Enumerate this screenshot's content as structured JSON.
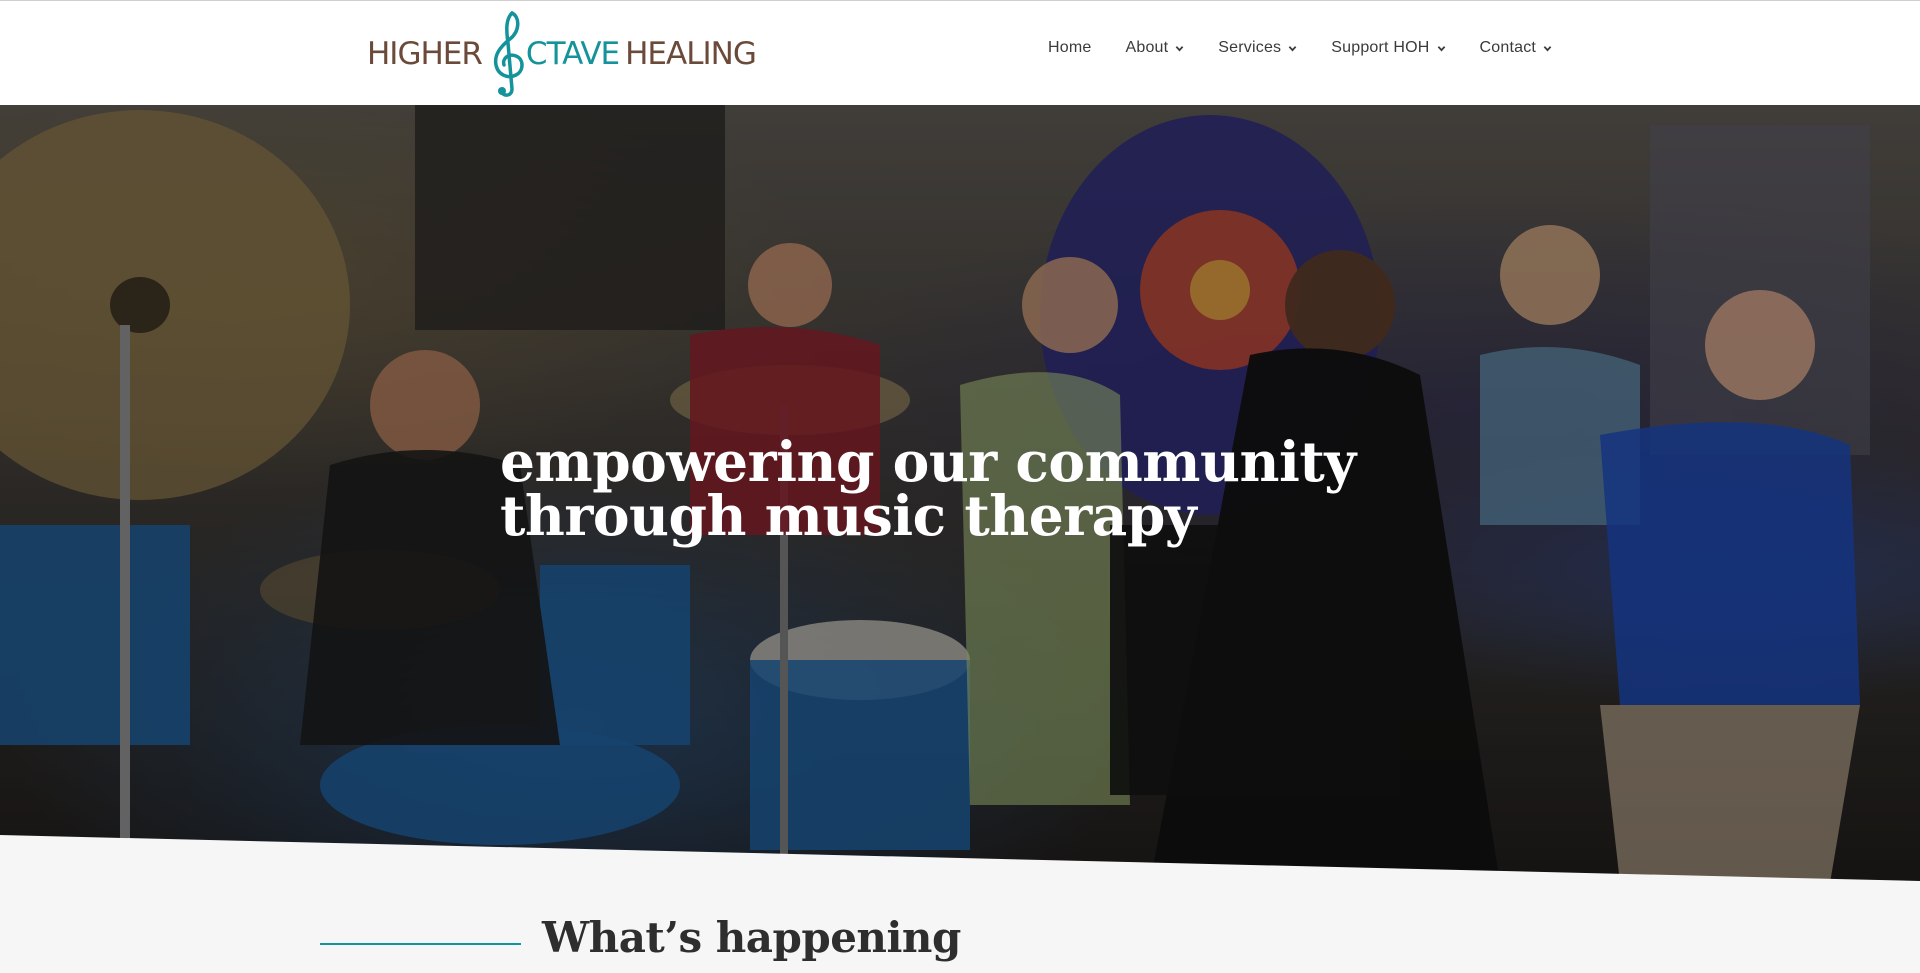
{
  "brand": {
    "name_part1": "HIGHER",
    "name_part2": "CTAVE",
    "name_part3": "HEALING",
    "logo_icon": "treble-clef-icon",
    "primary_color": "#14939a",
    "secondary_color": "#6b4a3a"
  },
  "nav": {
    "items": [
      {
        "label": "Home",
        "has_dropdown": false
      },
      {
        "label": "About",
        "has_dropdown": true
      },
      {
        "label": "Services",
        "has_dropdown": true
      },
      {
        "label": "Support HOH",
        "has_dropdown": true
      },
      {
        "label": "Contact",
        "has_dropdown": true
      }
    ],
    "dropdown_icon": "chevron-down-icon"
  },
  "hero": {
    "line1": "empowering our community",
    "line2": "through music therapy"
  },
  "section": {
    "title": "What’s happening"
  }
}
